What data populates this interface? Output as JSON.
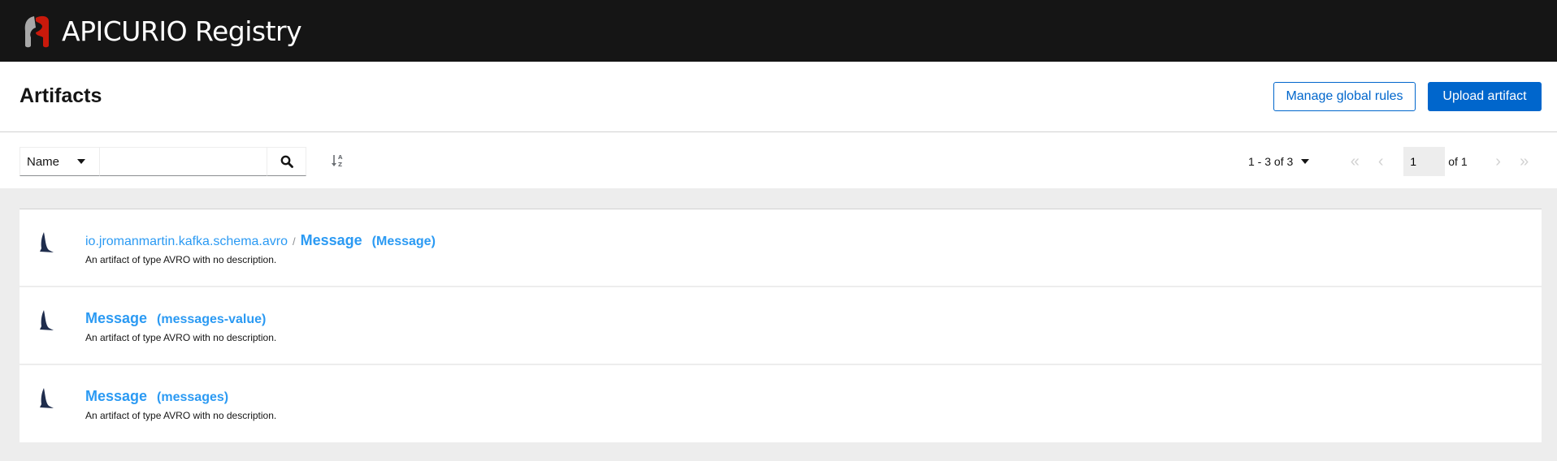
{
  "header": {
    "brand": "APICURIO Registry"
  },
  "page": {
    "title": "Artifacts",
    "manage_rules": "Manage global rules",
    "upload": "Upload artifact"
  },
  "toolbar": {
    "filter_by": "Name",
    "search_value": "",
    "search_placeholder": "",
    "pagination": {
      "range": "1 - 3 of 3",
      "page": "1",
      "of_pages": "of 1"
    }
  },
  "artifacts": [
    {
      "group": "io.jromanmartin.kafka.schema.avro",
      "separator": "/",
      "name": "Message",
      "id": "(Message)",
      "description": "An artifact of type AVRO with no description.",
      "type_icon": "avro-icon"
    },
    {
      "group": "",
      "name": "Message",
      "id": "(messages-value)",
      "description": "An artifact of type AVRO with no description.",
      "type_icon": "avro-icon"
    },
    {
      "group": "",
      "name": "Message",
      "id": "(messages)",
      "description": "An artifact of type AVRO with no description.",
      "type_icon": "avro-icon"
    }
  ],
  "colors": {
    "accent": "#0066cc",
    "link": "#2b9af3",
    "masthead": "#151515"
  }
}
